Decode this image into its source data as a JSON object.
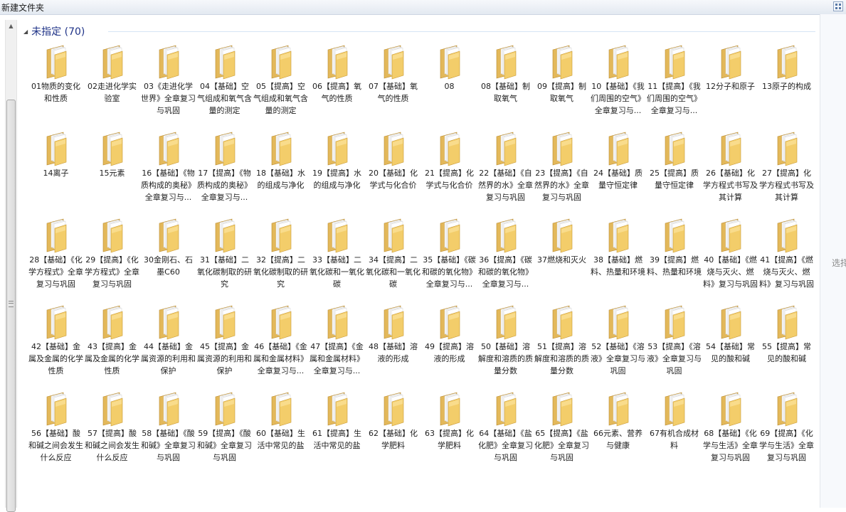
{
  "window": {
    "title": "新建文件夹"
  },
  "group": {
    "label": "未指定 (70)"
  },
  "right_pane": {
    "hint": "选择"
  },
  "items": [
    {
      "name": "01物质的变化和性质"
    },
    {
      "name": "02走进化学实验室"
    },
    {
      "name": "03《走进化学世界》全章复习与巩固"
    },
    {
      "name": "04【基础】空气组成和氧气含量的测定"
    },
    {
      "name": "05【提高】空气组成和氧气含量的测定"
    },
    {
      "name": "06【提高】氧气的性质"
    },
    {
      "name": "07【基础】氧气的性质"
    },
    {
      "name": "08"
    },
    {
      "name": "08【基础】制取氧气"
    },
    {
      "name": "09【提高】制取氧气"
    },
    {
      "name": "10【基础】《我们周围的空气》全章复习与..."
    },
    {
      "name": "11【提高】《我们周围的空气》全章复习与..."
    },
    {
      "name": "12分子和原子"
    },
    {
      "name": "13原子的构成"
    },
    {
      "name": "14离子"
    },
    {
      "name": "15元素"
    },
    {
      "name": "16【基础】《物质构成的奥秘》全章复习与..."
    },
    {
      "name": "17【提高】《物质构成的奥秘》全章复习与..."
    },
    {
      "name": "18【基础】水的组成与净化"
    },
    {
      "name": "19【提高】水的组成与净化"
    },
    {
      "name": "20【基础】化学式与化合价"
    },
    {
      "name": "21【提高】化学式与化合价"
    },
    {
      "name": "22【基础】《自然界的水》全章复习与巩固"
    },
    {
      "name": "23【提高】《自然界的水》全章复习与巩固"
    },
    {
      "name": "24【基础】质量守恒定律"
    },
    {
      "name": "25【提高】质量守恒定律"
    },
    {
      "name": "26【基础】化学方程式书写及其计算"
    },
    {
      "name": "27【提高】化学方程式书写及其计算"
    },
    {
      "name": "28【基础】《化学方程式》全章复习与巩固"
    },
    {
      "name": "29【提高】《化学方程式》全章复习与巩固"
    },
    {
      "name": "30金刚石、石墨C60"
    },
    {
      "name": "31【基础】二氧化碳制取的研究"
    },
    {
      "name": "32【提高】二氧化碳制取的研究"
    },
    {
      "name": "33【基础】二氧化碳和一氧化碳"
    },
    {
      "name": "34【提高】二氧化碳和一氧化碳"
    },
    {
      "name": "35【基础】《碳和碳的氧化物》全章复习与..."
    },
    {
      "name": "36【提高】《碳和碳的氧化物》全章复习与..."
    },
    {
      "name": "37燃烧和灭火"
    },
    {
      "name": "38【基础】燃料、热量和环境"
    },
    {
      "name": "39【提高】燃料、热量和环境"
    },
    {
      "name": "40【基础】《燃烧与灭火、燃料》复习与巩固"
    },
    {
      "name": "41【提高】《燃烧与灭火、燃料》复习与巩固"
    },
    {
      "name": "42【基础】金属及金属的化学性质"
    },
    {
      "name": "43【提高】金属及金属的化学性质"
    },
    {
      "name": "44【基础】金属资源的利用和保护"
    },
    {
      "name": "45【提高】金属资源的利用和保护"
    },
    {
      "name": "46【基础】《金属和金属材料》全章复习与..."
    },
    {
      "name": "47【提高】《金属和金属材料》全章复习与..."
    },
    {
      "name": "48【基础】溶液的形成"
    },
    {
      "name": "49【提高】溶液的形成"
    },
    {
      "name": "50【基础】溶解度和溶质的质量分数"
    },
    {
      "name": "51【提高】溶解度和溶质的质量分数"
    },
    {
      "name": "52【基础】《溶液》全章复习与巩固"
    },
    {
      "name": "53【提高】《溶液》全章复习与巩固"
    },
    {
      "name": "54【基础】常见的酸和碱"
    },
    {
      "name": "55【提高】常见的酸和碱"
    },
    {
      "name": "56【基础】酸和碱之间会发生什么反应"
    },
    {
      "name": "57【提高】酸和碱之间会发生什么反应"
    },
    {
      "name": "58【基础】《酸和碱》全章复习与巩固"
    },
    {
      "name": "59【提高】《酸和碱》全章复习与巩固"
    },
    {
      "name": "60【基础】生活中常见的盐"
    },
    {
      "name": "61【提高】生活中常见的盐"
    },
    {
      "name": "62【基础】化学肥料"
    },
    {
      "name": "63【提高】化学肥料"
    },
    {
      "name": "64【基础】《盐 化肥》全章复习与巩固"
    },
    {
      "name": "65【提高】《盐 化肥》全章复习与巩固"
    },
    {
      "name": "66元素、营养与健康"
    },
    {
      "name": "67有机合成材料"
    },
    {
      "name": "68【基础】《化学与生活》全章复习与巩固"
    },
    {
      "name": "69【提高】《化学与生活》全章复习与巩固"
    }
  ]
}
